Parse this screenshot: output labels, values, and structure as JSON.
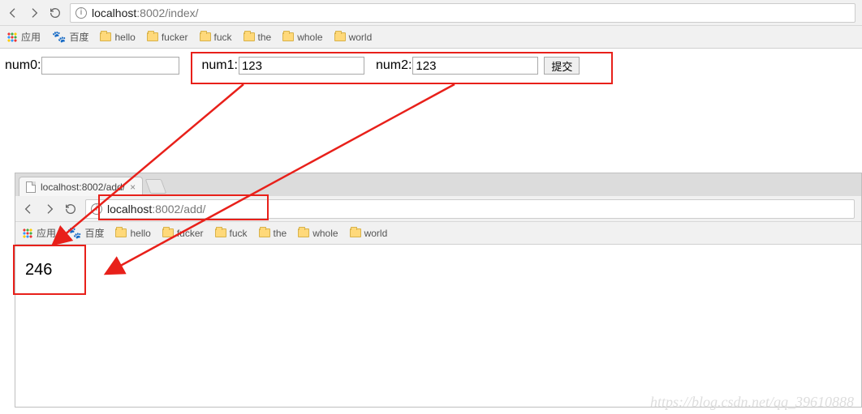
{
  "browser1": {
    "url_host": "localhost",
    "url_port_path": ":8002/index/",
    "apps_label": "应用",
    "baidu_label": "百度",
    "bookmarks": [
      "hello",
      "fucker",
      "fuck",
      "the",
      "whole",
      "world"
    ]
  },
  "form": {
    "num0_label": "num0:",
    "num0_value": "",
    "num1_label": "num1:",
    "num1_value": "123",
    "num2_label": "num2:",
    "num2_value": "123",
    "submit_label": "提交"
  },
  "browser2": {
    "tab_title": "localhost:8002/add/",
    "url_host": "localhost",
    "url_port_path": ":8002/add/",
    "apps_label": "应用",
    "baidu_label": "百度",
    "bookmarks": [
      "hello",
      "fucker",
      "fuck",
      "the",
      "whole",
      "world"
    ]
  },
  "result_value": "246",
  "watermark": "https://blog.csdn.net/qq_39610888"
}
